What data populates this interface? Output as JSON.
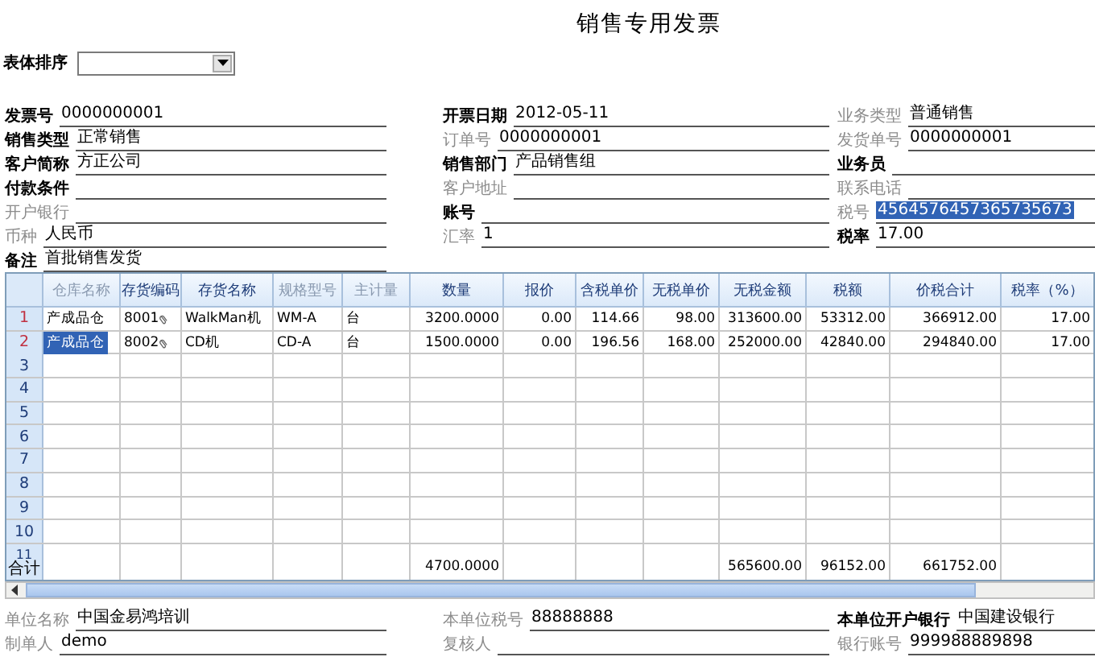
{
  "title": "销售专用发票",
  "sort": {
    "label": "表体排序"
  },
  "header_columns": [
    [
      {
        "label": "发票号",
        "value": "0000000001",
        "required": true,
        "selected": false
      },
      {
        "label": "销售类型",
        "value": "正常销售",
        "required": true,
        "selected": false
      },
      {
        "label": "客户简称",
        "value": "方正公司",
        "required": true,
        "selected": false
      },
      {
        "label": "付款条件",
        "required": true,
        "selected": false
      },
      {
        "label": "开户银行",
        "required": false,
        "selected": false
      },
      {
        "label": "币种",
        "value": "人民币",
        "required": false,
        "selected": false
      },
      {
        "label": "备注",
        "value": "首批销售发货",
        "required": true,
        "selected": false
      }
    ],
    [
      {
        "label": "开票日期",
        "value": "2012-05-11",
        "required": true,
        "selected": false
      },
      {
        "label": "订单号",
        "value": "0000000001",
        "required": false,
        "selected": false
      },
      {
        "label": "销售部门",
        "value": "产品销售组",
        "required": true,
        "selected": false
      },
      {
        "label": "客户地址",
        "required": false,
        "selected": false
      },
      {
        "label": "账号",
        "required": true,
        "selected": false
      },
      {
        "label": "汇率",
        "value": "1",
        "required": false,
        "selected": false
      }
    ],
    [
      {
        "label": "业务类型",
        "value": "普通销售",
        "required": false,
        "selected": false
      },
      {
        "label": "发货单号",
        "value": "0000000001",
        "required": false,
        "selected": false
      },
      {
        "label": "业务员",
        "required": true,
        "selected": false
      },
      {
        "label": "联系电话",
        "required": false,
        "selected": false
      },
      {
        "label": "税号",
        "value": "4564576457365735673",
        "required": false,
        "selected": true
      },
      {
        "label": "税率",
        "value": "17.00",
        "required": true,
        "selected": false
      }
    ]
  ],
  "table": {
    "columns": [
      {
        "label": "仓库名称",
        "dim": true,
        "kind": "text"
      },
      {
        "label": "存货编码",
        "dim": false,
        "kind": "code"
      },
      {
        "label": "存货名称",
        "dim": false,
        "kind": "text"
      },
      {
        "label": "规格型号",
        "dim": true,
        "kind": "text"
      },
      {
        "label": "主计量",
        "dim": true,
        "kind": "text"
      },
      {
        "label": "数量",
        "dim": false,
        "kind": "number"
      },
      {
        "label": "报价",
        "dim": false,
        "kind": "number"
      },
      {
        "label": "含税单价",
        "dim": false,
        "kind": "number"
      },
      {
        "label": "无税单价",
        "dim": false,
        "kind": "number"
      },
      {
        "label": "无税金额",
        "dim": false,
        "kind": "number"
      },
      {
        "label": "税额",
        "dim": false,
        "kind": "number"
      },
      {
        "label": "价税合计",
        "dim": false,
        "kind": "number"
      },
      {
        "label": "税率（%）",
        "dim": false,
        "kind": "number"
      }
    ],
    "rows": [
      {
        "number": "1",
        "cells": [
          {
            "text": "产成品仓",
            "selected": false
          },
          {
            "text": "8001",
            "selected": false
          },
          {
            "text": "WalkMan机",
            "selected": false
          },
          {
            "text": "WM-A",
            "selected": false
          },
          {
            "text": "台",
            "selected": false
          },
          {
            "text": "3200.0000",
            "selected": false
          },
          {
            "text": "0.00",
            "selected": false
          },
          {
            "text": "114.66",
            "selected": false
          },
          {
            "text": "98.00",
            "selected": false
          },
          {
            "text": "313600.00",
            "selected": false
          },
          {
            "text": "53312.00",
            "selected": false
          },
          {
            "text": "366912.00",
            "selected": false
          },
          {
            "text": "17.00",
            "selected": false
          }
        ]
      },
      {
        "number": "2",
        "cells": [
          {
            "text": "产成品仓",
            "selected": true
          },
          {
            "text": "8002",
            "selected": false
          },
          {
            "text": "CD机",
            "selected": false
          },
          {
            "text": "CD-A",
            "selected": false
          },
          {
            "text": "台",
            "selected": false
          },
          {
            "text": "1500.0000",
            "selected": false
          },
          {
            "text": "0.00",
            "selected": false
          },
          {
            "text": "196.56",
            "selected": false
          },
          {
            "text": "168.00",
            "selected": false
          },
          {
            "text": "252000.00",
            "selected": false
          },
          {
            "text": "42840.00",
            "selected": false
          },
          {
            "text": "294840.00",
            "selected": false
          },
          {
            "text": "17.00",
            "selected": false
          }
        ]
      }
    ],
    "empty_rows": [
      "3",
      "4",
      "5",
      "6",
      "7",
      "8",
      "9",
      "10"
    ],
    "total_row": {
      "number": "11",
      "label": "合计",
      "cells": [
        null,
        null,
        null,
        null,
        null,
        "4700.0000",
        null,
        null,
        null,
        "565600.00",
        "96152.00",
        "661752.00",
        null
      ]
    }
  },
  "footer_columns": [
    [
      {
        "label": "单位名称",
        "value": "中国金易鸿培训",
        "required": false,
        "selected": false
      },
      {
        "label": "制单人",
        "value": "demo",
        "required": false,
        "selected": false
      }
    ],
    [
      {
        "label": "本单位税号",
        "value": "88888888",
        "required": false,
        "selected": false
      },
      {
        "label": "复核人",
        "required": false,
        "selected": false
      }
    ],
    [
      {
        "label": "本单位开户银行",
        "value": "中国建设银行",
        "required": true,
        "selected": false
      },
      {
        "label": "银行账号",
        "value": "999988889898",
        "required": false,
        "selected": false
      }
    ]
  ]
}
